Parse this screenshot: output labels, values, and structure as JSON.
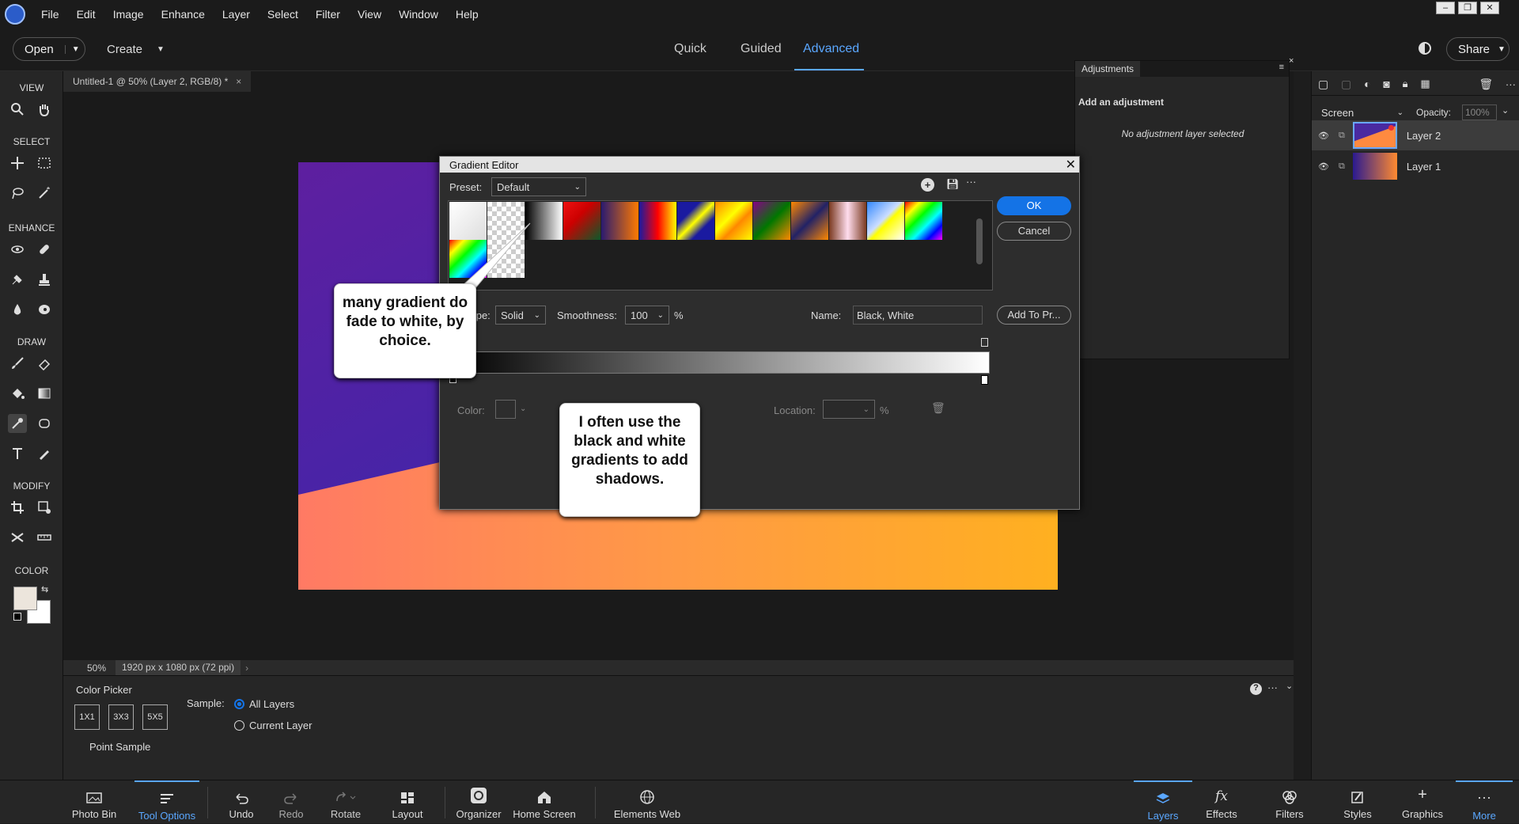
{
  "menu": {
    "items": [
      "File",
      "Edit",
      "Image",
      "Enhance",
      "Layer",
      "Select",
      "Filter",
      "View",
      "Window",
      "Help"
    ]
  },
  "modebar": {
    "open_label": "Open",
    "create_label": "Create",
    "modes": [
      "Quick",
      "Guided",
      "Advanced"
    ],
    "active_mode": "Advanced",
    "share_label": "Share"
  },
  "document": {
    "tab_title": "Untitled-1 @ 50% (Layer 2, RGB/8) *",
    "zoom": "50%",
    "dimensions": "1920 px x 1080 px (72 ppi)"
  },
  "toolbar": {
    "sections": [
      "VIEW",
      "SELECT",
      "ENHANCE",
      "DRAW",
      "MODIFY",
      "COLOR"
    ]
  },
  "adjustments": {
    "tab": "Adjustments",
    "heading": "Add an adjustment",
    "empty_text": "No adjustment layer selected"
  },
  "layers_panel": {
    "blend_mode": "Screen",
    "opacity_label": "Opacity:",
    "opacity_value": "100%",
    "layers": [
      {
        "name": "Layer 2"
      },
      {
        "name": "Layer 1"
      }
    ]
  },
  "gradient_editor": {
    "title": "Gradient Editor",
    "preset_label": "Preset:",
    "preset_value": "Default",
    "ok_label": "OK",
    "cancel_label": "Cancel",
    "type_label": "Type:",
    "type_value": "Solid",
    "smoothness_label": "Smoothness:",
    "smoothness_value": "100",
    "percent": "%",
    "name_label": "Name:",
    "name_value": "Black, White",
    "add_to_preset_label": "Add To Pr...",
    "color_label": "Color:",
    "location_label": "Location:"
  },
  "callouts": {
    "left": "many gradient do fade to white, by choice.",
    "right": "I often use the black and white gradients to add shadows."
  },
  "tool_options": {
    "tool_name": "Color Picker",
    "sizes": [
      "1X1",
      "3X3",
      "5X5"
    ],
    "sample_label": "Sample:",
    "sample_options": [
      "All Layers",
      "Current Layer"
    ],
    "sample_selected": "All Layers",
    "point_sample": "Point Sample"
  },
  "bottom_bar": {
    "left_items": [
      "Photo Bin",
      "Tool Options",
      "Undo",
      "Redo",
      "Rotate",
      "Layout",
      "Organizer",
      "Home Screen",
      "Elements Web"
    ],
    "active_left": "Tool Options",
    "right_items": [
      "Layers",
      "Effects",
      "Filters",
      "Styles",
      "Graphics",
      "More"
    ],
    "active_right": "Layers"
  },
  "colors": {
    "accent": "#1473e6",
    "active_tab": "#5aa7ff"
  }
}
